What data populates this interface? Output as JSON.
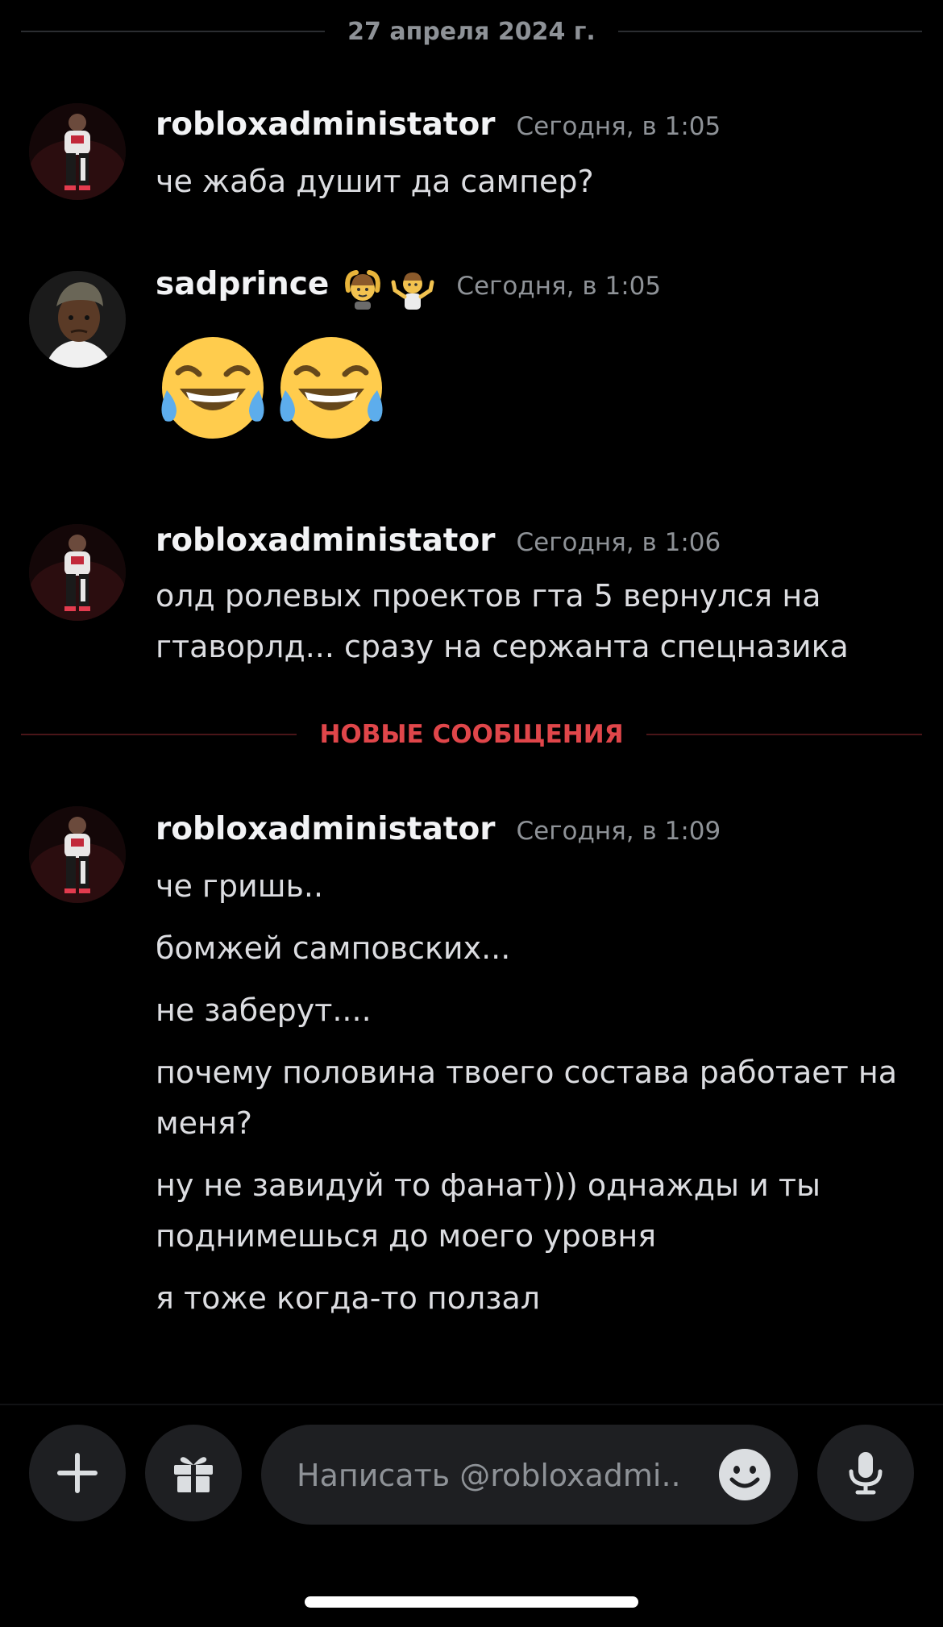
{
  "date_divider": "27 апреля 2024 г.",
  "new_messages_divider": "НОВЫЕ СООБЩЕНИЯ",
  "messages": [
    {
      "username": "robloxadministator",
      "timestamp": "Сегодня, в 1:05",
      "lines": [
        "че жаба душит да сампер?"
      ]
    },
    {
      "username": "sadprince",
      "badges": [
        "person-gesturing-ok-emoji",
        "person-shrugging-emoji"
      ],
      "timestamp": "Сегодня, в 1:05",
      "emojis": [
        "face-with-tears-of-joy",
        "face-with-tears-of-joy"
      ]
    },
    {
      "username": "robloxadministator",
      "timestamp": "Сегодня, в 1:06",
      "lines": [
        "олд ролевых проектов гта 5 вернулся на гтаворлд... сразу на сержанта спецназика"
      ]
    },
    {
      "username": "robloxadministator",
      "timestamp": "Сегодня, в 1:09",
      "lines": [
        "че гришь..",
        "бомжей самповских...",
        "не заберут....",
        "почему половина твоего состава работает на меня?",
        "ну не завидуй то фанат))) однажды и ты поднимешься до моего уровня",
        "я тоже когда-то ползал"
      ]
    }
  ],
  "composer": {
    "placeholder": "Написать @robloxadmi.."
  },
  "colors": {
    "background": "#000000",
    "new_messages_red": "#e0464a",
    "muted": "#8e9297"
  }
}
